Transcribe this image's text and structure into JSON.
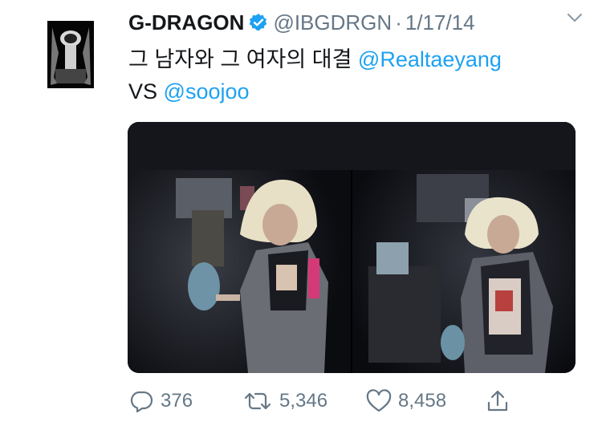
{
  "tweet": {
    "author_name": "G-DRAGON",
    "handle": "@IBGDRGN",
    "separator": "·",
    "date": "1/17/14",
    "text_prefix": "그 남자와 그 여자의 대결 ",
    "mention_1": "@Realtaeyang",
    "text_vs": "VS ",
    "mention_2": "@soojoo",
    "verified": true
  },
  "actions": {
    "replies": "376",
    "retweets": "5,346",
    "likes": "8,458"
  },
  "icons": {
    "verified": "verified-badge-icon",
    "caret": "chevron-down-icon",
    "reply": "reply-icon",
    "retweet": "retweet-icon",
    "like": "heart-icon",
    "share": "share-icon"
  },
  "colors": {
    "accent": "#1da1f2",
    "secondary_text": "#657786",
    "primary_text": "#14171a"
  }
}
